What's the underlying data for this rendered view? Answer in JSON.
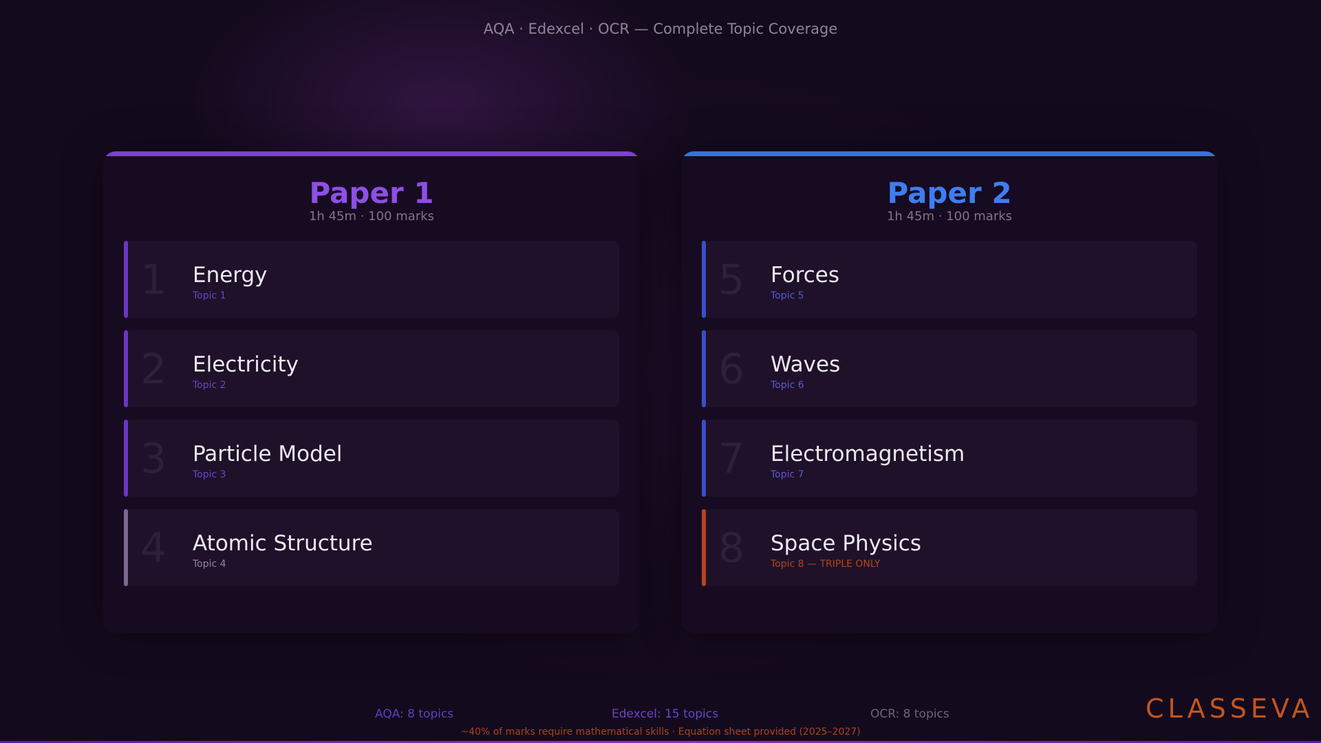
{
  "header": {
    "subtitle": "AQA · Edexcel · OCR — Complete Topic Coverage"
  },
  "papers": [
    {
      "title": "Paper 1",
      "meta": "1h 45m · 100 marks",
      "accent": "#7b3fd6",
      "topics": [
        {
          "number": "1",
          "name": "Energy",
          "label": "Topic 1",
          "bar_color": "#6a35c4",
          "label_color": "#6a45c8"
        },
        {
          "number": "2",
          "name": "Electricity",
          "label": "Topic 2",
          "bar_color": "#6a35c4",
          "label_color": "#6a45c8"
        },
        {
          "number": "3",
          "name": "Particle Model",
          "label": "Topic 3",
          "bar_color": "#6a35c4",
          "label_color": "#6a45c8"
        },
        {
          "number": "4",
          "name": "Atomic Structure",
          "label": "Topic 4",
          "bar_color": "#7b6890",
          "label_color": "#8f86a0"
        }
      ]
    },
    {
      "title": "Paper 2",
      "meta": "1h 45m · 100 marks",
      "accent": "#3d6fe0",
      "topics": [
        {
          "number": "5",
          "name": "Forces",
          "label": "Topic 5",
          "bar_color": "#3a4fc8",
          "label_color": "#5a5ad0"
        },
        {
          "number": "6",
          "name": "Waves",
          "label": "Topic 6",
          "bar_color": "#3a4fc8",
          "label_color": "#5a5ad0"
        },
        {
          "number": "7",
          "name": "Electromagnetism",
          "label": "Topic 7",
          "bar_color": "#3a4fc8",
          "label_color": "#5a5ad0"
        },
        {
          "number": "8",
          "name": "Space Physics",
          "label": "Topic 8 — TRIPLE ONLY",
          "bar_color": "#b4461e",
          "label_color": "#b4461e"
        }
      ]
    }
  ],
  "footer": {
    "aqa": "AQA: 8 topics",
    "edexcel": "Edexcel: 15 topics",
    "ocr": "OCR: 8 topics",
    "note": "~40% of marks require mathematical skills · Equation sheet provided (2025–2027)"
  },
  "brand": {
    "logo_text": "CLASSEVA",
    "color": "#c2561f"
  }
}
